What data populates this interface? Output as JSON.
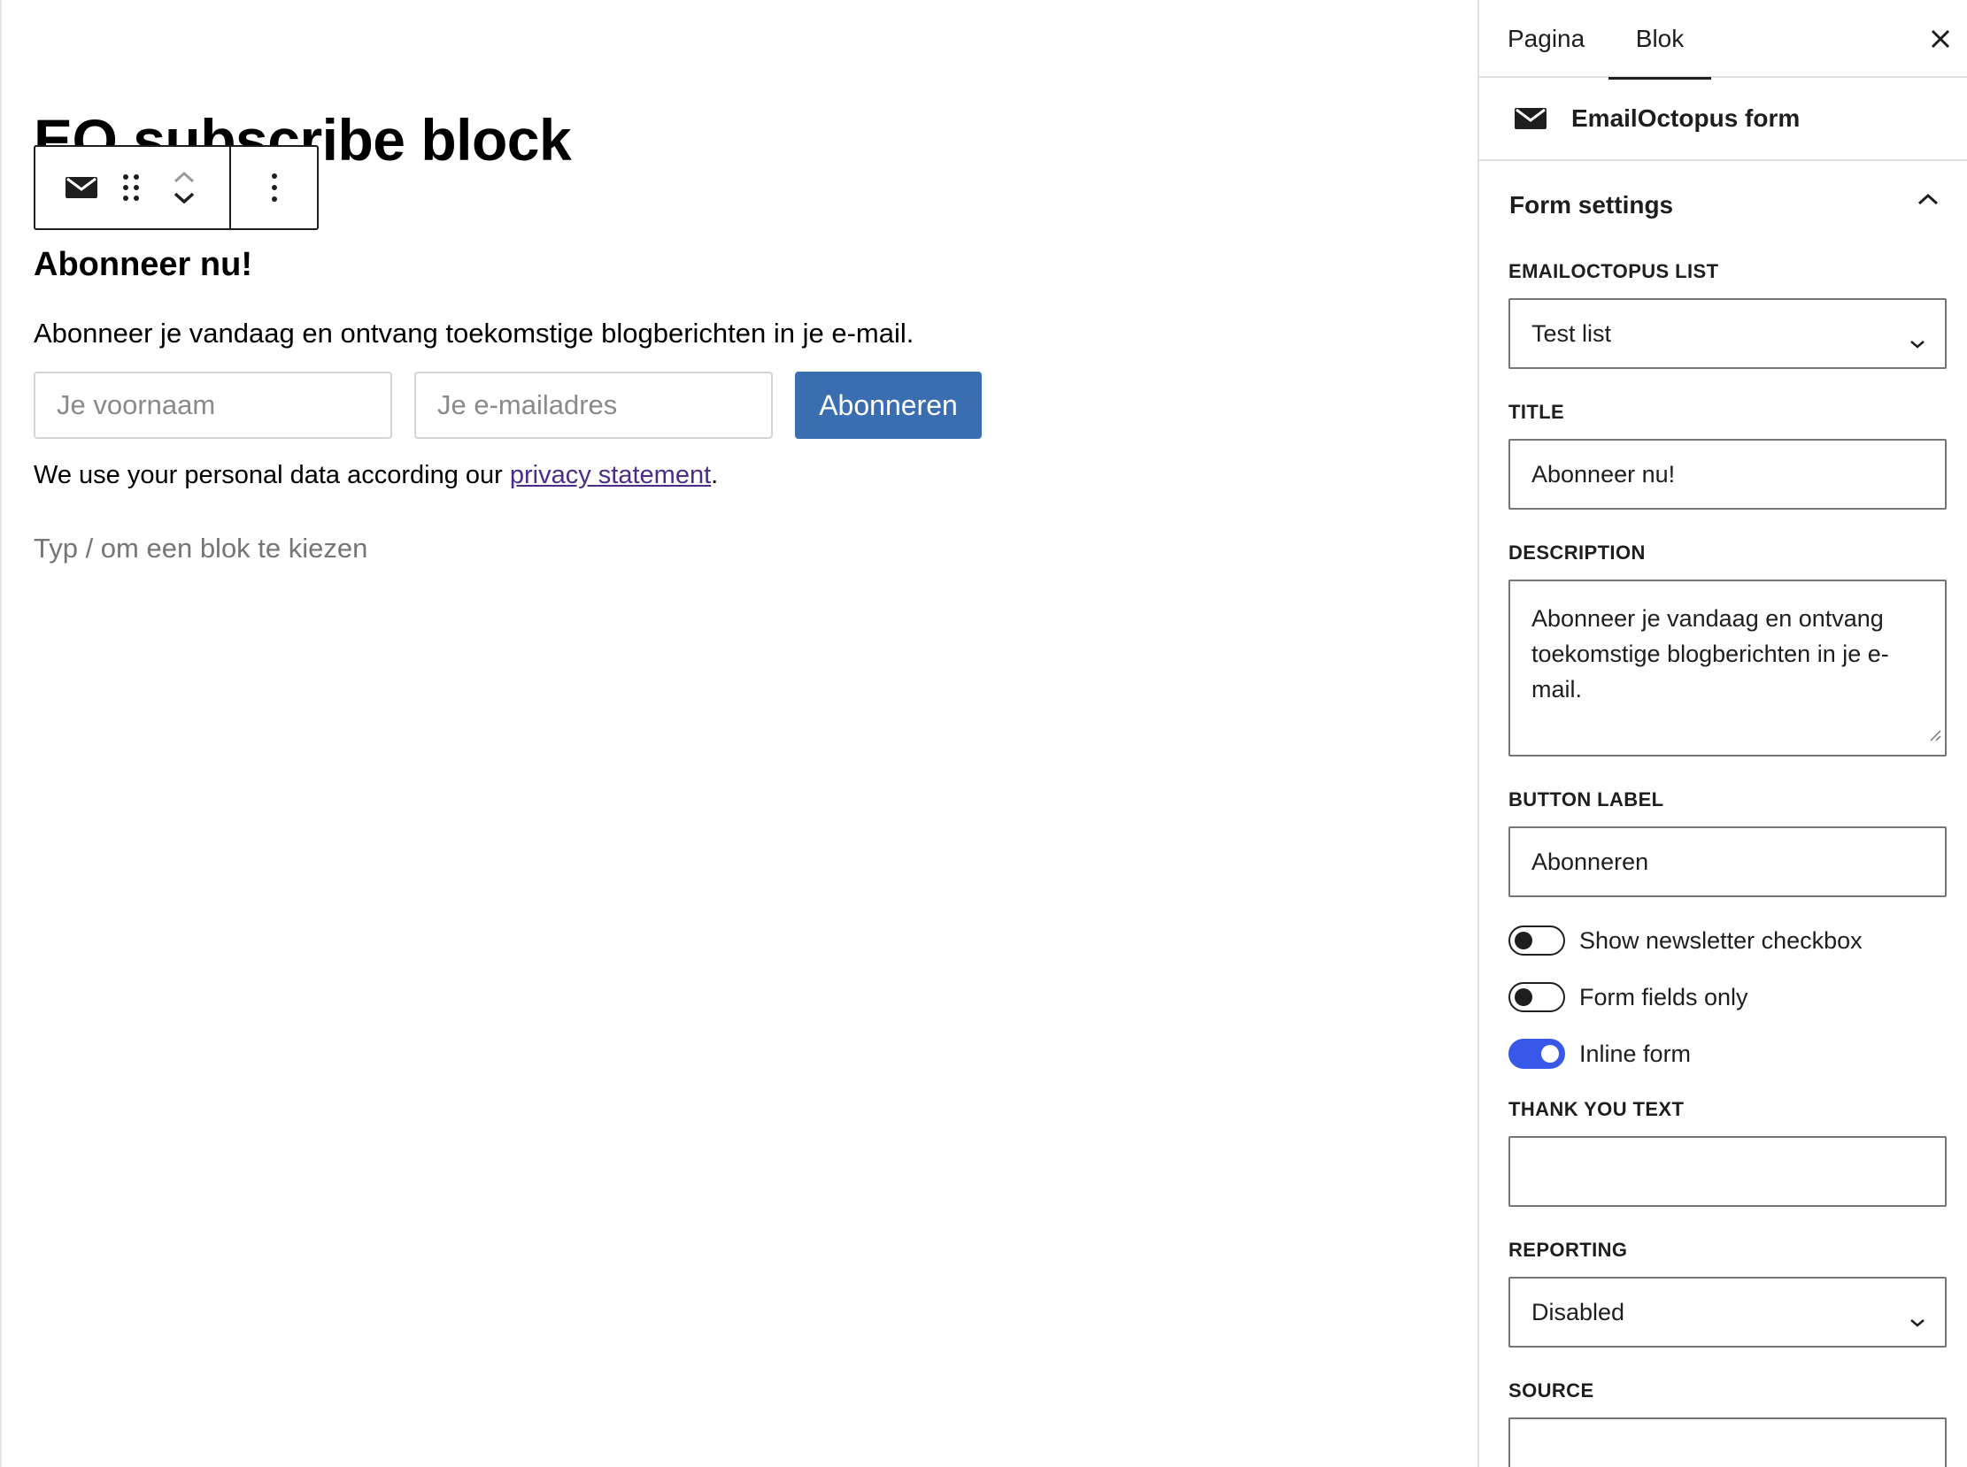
{
  "editor": {
    "post_title": "EO subscribe block",
    "form": {
      "title": "Abonneer nu!",
      "description": "Abonneer je vandaag en ontvang toekomstige blogberichten in je e-mail.",
      "first_name_placeholder": "Je voornaam",
      "email_placeholder": "Je e-mailadres",
      "button_label": "Abonneren",
      "privacy_prefix": "We use your personal data according our ",
      "privacy_link": "privacy statement",
      "privacy_suffix": "."
    },
    "appender_placeholder": "Typ / om een blok te kiezen",
    "toolbar_icons": [
      "envelope-icon",
      "drag-handle-icon",
      "chevron-up-icon",
      "chevron-down-icon",
      "more-vertical-icon"
    ]
  },
  "sidebar": {
    "tabs": [
      {
        "label": "Pagina",
        "active": false
      },
      {
        "label": "Blok",
        "active": true
      }
    ],
    "block_name": "EmailOctopus form",
    "panel_title": "Form settings",
    "fields": {
      "list_label": "EMAILOCTOPUS LIST",
      "list_value": "Test list",
      "title_label": "TITLE",
      "title_value": "Abonneer nu!",
      "description_label": "DESCRIPTION",
      "description_value": "Abonneer je vandaag en ontvang toekomstige blogberichten in je e-mail.",
      "button_label_label": "BUTTON LABEL",
      "button_label_value": "Abonneren",
      "thank_you_label": "THANK YOU TEXT",
      "thank_you_value": "",
      "reporting_label": "REPORTING",
      "reporting_value": "Disabled",
      "source_label": "SOURCE",
      "source_value": ""
    },
    "toggles": [
      {
        "label": "Show newsletter checkbox",
        "on": false
      },
      {
        "label": "Form fields only",
        "on": false
      },
      {
        "label": "Inline form",
        "on": true
      }
    ]
  },
  "colors": {
    "accent": "#3858e9",
    "button": "#3a6eb0",
    "link": "#4b2c86",
    "text": "#1e1e1e"
  }
}
